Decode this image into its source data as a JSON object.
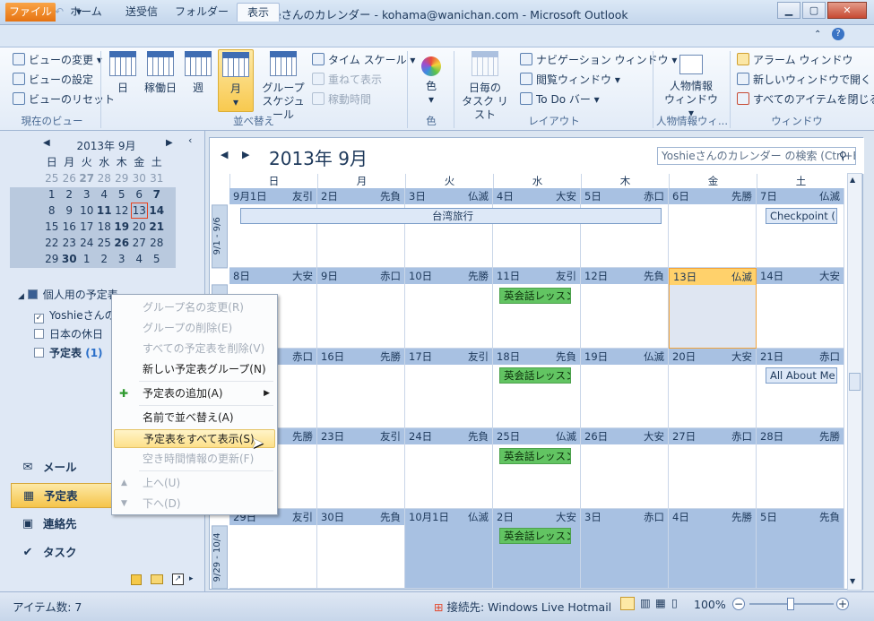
{
  "window": {
    "title": "Yoshieさんのカレンダー - kohama@wanichan.com - Microsoft Outlook"
  },
  "tabs": [
    {
      "label": "ファイル"
    },
    {
      "label": "ホーム"
    },
    {
      "label": "送受信"
    },
    {
      "label": "フォルダー"
    },
    {
      "label": "表示"
    }
  ],
  "ribbon": {
    "current_view": {
      "change": "ビューの変更",
      "settings": "ビューの設定",
      "reset": "ビューのリセット",
      "label": "現在のビュー"
    },
    "arrange": {
      "day": "日",
      "workweek": "稼働日",
      "week": "週",
      "month": "月",
      "group1": "グループ",
      "group2": "スケジュール",
      "timescale": "タイム スケール",
      "overlay": "重ねて表示",
      "worktime": "稼動時間",
      "label": "並べ替え"
    },
    "color": {
      "btn": "色",
      "label": "色"
    },
    "layout": {
      "daily1": "日毎の",
      "daily2": "タスク リスト",
      "navpane": "ナビゲーション ウィンドウ",
      "reading": "閲覧ウィンドウ",
      "todo": "To Do バー",
      "label": "レイアウト"
    },
    "people": {
      "btn1": "人物情報",
      "btn2": "ウィンドウ",
      "label": "人物情報ウィ..."
    },
    "window": {
      "alarm": "アラーム ウィンドウ",
      "newwin": "新しいウィンドウで開く",
      "closeall": "すべてのアイテムを閉じる",
      "label": "ウィンドウ"
    }
  },
  "minical": {
    "title": "2013年 9月",
    "weekdays": [
      "日",
      "月",
      "火",
      "水",
      "木",
      "金",
      "土"
    ]
  },
  "tree": {
    "group": "個人用の予定表",
    "cal1": "Yoshieさんの",
    "cal2": "日本の休日",
    "cal3": "予定表",
    "cal3_count": "(1)"
  },
  "context_menu": {
    "rename": "グループ名の変更(R)",
    "delete": "グループの削除(E)",
    "delete_all": "すべての予定表を削除(V)",
    "new_group": "新しい予定表グループ(N)",
    "add": "予定表の追加(A)",
    "sort": "名前で並べ替え(A)",
    "show_all": "予定表をすべて表示(S)",
    "refresh": "空き時間情報の更新(F)",
    "up": "上へ(U)",
    "down": "下へ(D)"
  },
  "nav_buttons": {
    "mail": "メール",
    "calendar": "予定表",
    "contacts": "連絡先",
    "tasks": "タスク"
  },
  "calendar": {
    "title": "2013年 9月",
    "search_placeholder": "Yoshieさんのカレンダー の検索 (Ctrl+E)",
    "weekdays": [
      "日",
      "月",
      "火",
      "水",
      "木",
      "金",
      "土"
    ],
    "week_labels": [
      "9/1 - 9/6",
      "",
      "",
      "",
      "9/29 - 10/4"
    ],
    "days": [
      {
        "d": "9月1日",
        "r": "友引"
      },
      {
        "d": "2日",
        "r": "先負"
      },
      {
        "d": "3日",
        "r": "仏滅"
      },
      {
        "d": "4日",
        "r": "大安"
      },
      {
        "d": "5日",
        "r": "赤口"
      },
      {
        "d": "6日",
        "r": "先勝"
      },
      {
        "d": "7日",
        "r": "仏滅"
      },
      {
        "d": "8日",
        "r": "大安"
      },
      {
        "d": "9日",
        "r": "赤口"
      },
      {
        "d": "10日",
        "r": "先勝"
      },
      {
        "d": "11日",
        "r": "友引"
      },
      {
        "d": "12日",
        "r": "先負"
      },
      {
        "d": "13日",
        "r": "仏滅"
      },
      {
        "d": "14日",
        "r": "大安"
      },
      {
        "d": "",
        "r": "赤口"
      },
      {
        "d": "16日",
        "r": "先勝"
      },
      {
        "d": "17日",
        "r": "友引"
      },
      {
        "d": "18日",
        "r": "先負"
      },
      {
        "d": "19日",
        "r": "仏滅"
      },
      {
        "d": "20日",
        "r": "大安"
      },
      {
        "d": "21日",
        "r": "赤口"
      },
      {
        "d": "",
        "r": "先勝"
      },
      {
        "d": "23日",
        "r": "友引"
      },
      {
        "d": "24日",
        "r": "先負"
      },
      {
        "d": "25日",
        "r": "仏滅"
      },
      {
        "d": "26日",
        "r": "大安"
      },
      {
        "d": "27日",
        "r": "赤口"
      },
      {
        "d": "28日",
        "r": "先勝"
      },
      {
        "d": "29日",
        "r": "友引"
      },
      {
        "d": "30日",
        "r": "先負"
      },
      {
        "d": "10月1日",
        "r": "仏滅"
      },
      {
        "d": "2日",
        "r": "大安"
      },
      {
        "d": "3日",
        "r": "赤口"
      },
      {
        "d": "4日",
        "r": "先勝"
      },
      {
        "d": "5日",
        "r": "先負"
      }
    ],
    "appointments": {
      "taiwan": "台湾旅行",
      "checkpoint": "Checkpoint (I",
      "eikaiwa": "英会話レッスン",
      "allabout": "All About Me"
    }
  },
  "status": {
    "items": "アイテム数: 7",
    "connection": "接続先: Windows Live Hotmail",
    "zoom": "100%"
  }
}
